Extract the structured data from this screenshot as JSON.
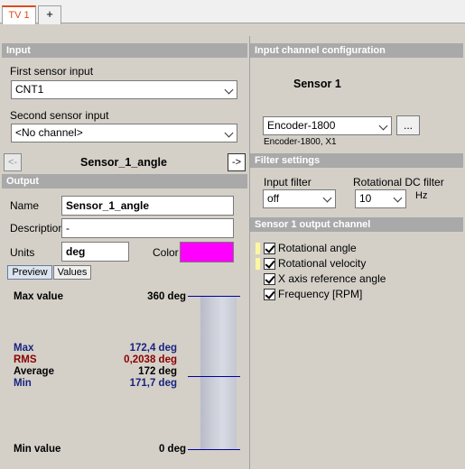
{
  "tabs": [
    {
      "label": "TV 1",
      "active": true
    },
    {
      "label": "+",
      "active": false
    }
  ],
  "input_section": {
    "header": "Input",
    "first_sensor_label": "First sensor input",
    "first_sensor_value": "CNT1",
    "second_sensor_label": "Second sensor input",
    "second_sensor_value": "<No channel>"
  },
  "navigator": {
    "prev_label": "<-",
    "next_label": "->",
    "current": "Sensor_1_angle"
  },
  "output_section": {
    "header": "Output",
    "name_label": "Name",
    "name_value": "Sensor_1_angle",
    "description_label": "Description",
    "description_value": "-",
    "units_label": "Units",
    "units_value": "deg",
    "color_label": "Color",
    "color_value": "#ff00ff",
    "preview_tabs": [
      "Preview",
      "Values"
    ]
  },
  "preview": {
    "max_value_label": "Max value",
    "max_value": "360 deg",
    "min_value_label": "Min value",
    "min_value": "0 deg",
    "stats": [
      {
        "label": "Max",
        "value": "172,4 deg",
        "color": "navy"
      },
      {
        "label": "RMS",
        "value": "0,2038 deg",
        "color": "maroon"
      },
      {
        "label": "Average",
        "value": "172 deg",
        "color": "black"
      },
      {
        "label": "Min",
        "value": "171,7 deg",
        "color": "navy"
      }
    ],
    "level_fraction": 0.478
  },
  "channel_config": {
    "header": "Input channel configuration",
    "sensor_title": "Sensor 1",
    "encoder_value": "Encoder-1800",
    "encoder_button": "...",
    "encoder_note": "Encoder-1800, X1"
  },
  "filter_settings": {
    "header": "Filter settings",
    "input_filter_label": "Input filter",
    "input_filter_value": "off",
    "dc_filter_label": "Rotational DC filter",
    "dc_filter_value": "10",
    "dc_filter_unit": "Hz"
  },
  "output_channels": {
    "header": "Sensor 1 output channel",
    "items": [
      {
        "label": "Rotational angle",
        "checked": true,
        "highlight": true
      },
      {
        "label": "Rotational velocity",
        "checked": true,
        "highlight": true
      },
      {
        "label": "X axis reference angle",
        "checked": true,
        "highlight": false
      },
      {
        "label": "Frequency [RPM]",
        "checked": true,
        "highlight": false
      }
    ]
  }
}
